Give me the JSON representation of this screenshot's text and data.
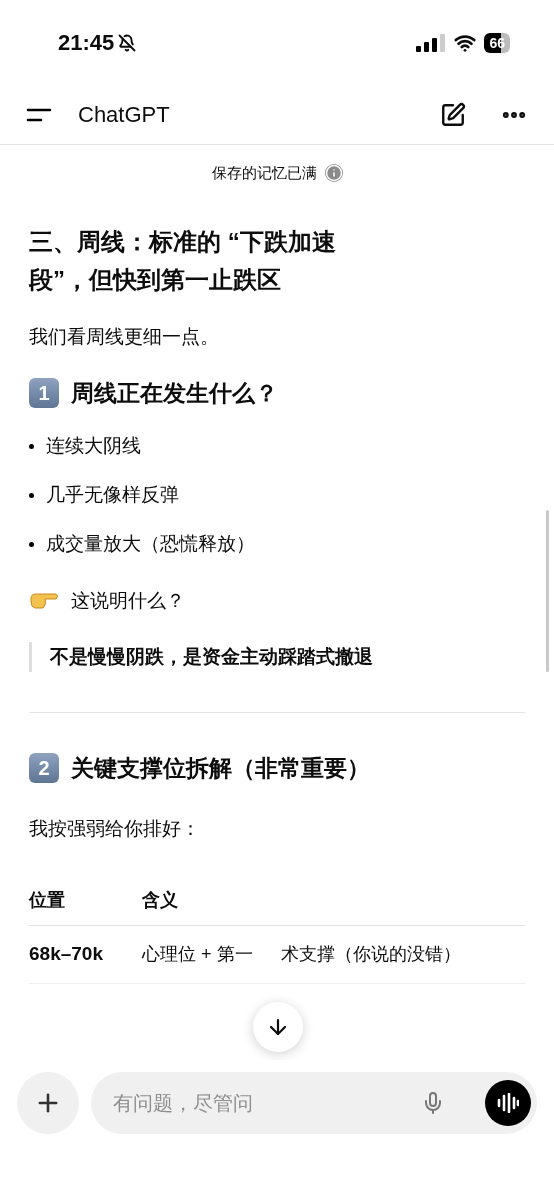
{
  "status_bar": {
    "time": "21:45",
    "battery": "66"
  },
  "header": {
    "title": "ChatGPT"
  },
  "banner": {
    "text": "保存的记忆已满"
  },
  "content": {
    "heading": "三、周线：标准的 “下跌加速段”，但快到第一止跌区",
    "intro": "我们看周线更细一点。",
    "section_1": {
      "badge": "1",
      "title": "周线正在发生什么？",
      "bullets": [
        "连续大阴线",
        "几乎无像样反弹",
        "成交量放大（恐慌释放）"
      ],
      "question": "这说明什么？",
      "quote": "不是慢慢阴跌，是资金主动踩踏式撤退"
    },
    "section_2": {
      "badge": "2",
      "title": "关键支撑位拆解（非常重要）",
      "intro": "我按强弱给你排好：",
      "table": {
        "columns": [
          "位置",
          "含义"
        ],
        "rows": [
          {
            "position": "68k–70k",
            "meaning_parts": [
              "心理位 + 第一",
              "术支撑（你说的没错）"
            ]
          }
        ]
      }
    }
  },
  "composer": {
    "placeholder": "有问题，尽管问"
  }
}
